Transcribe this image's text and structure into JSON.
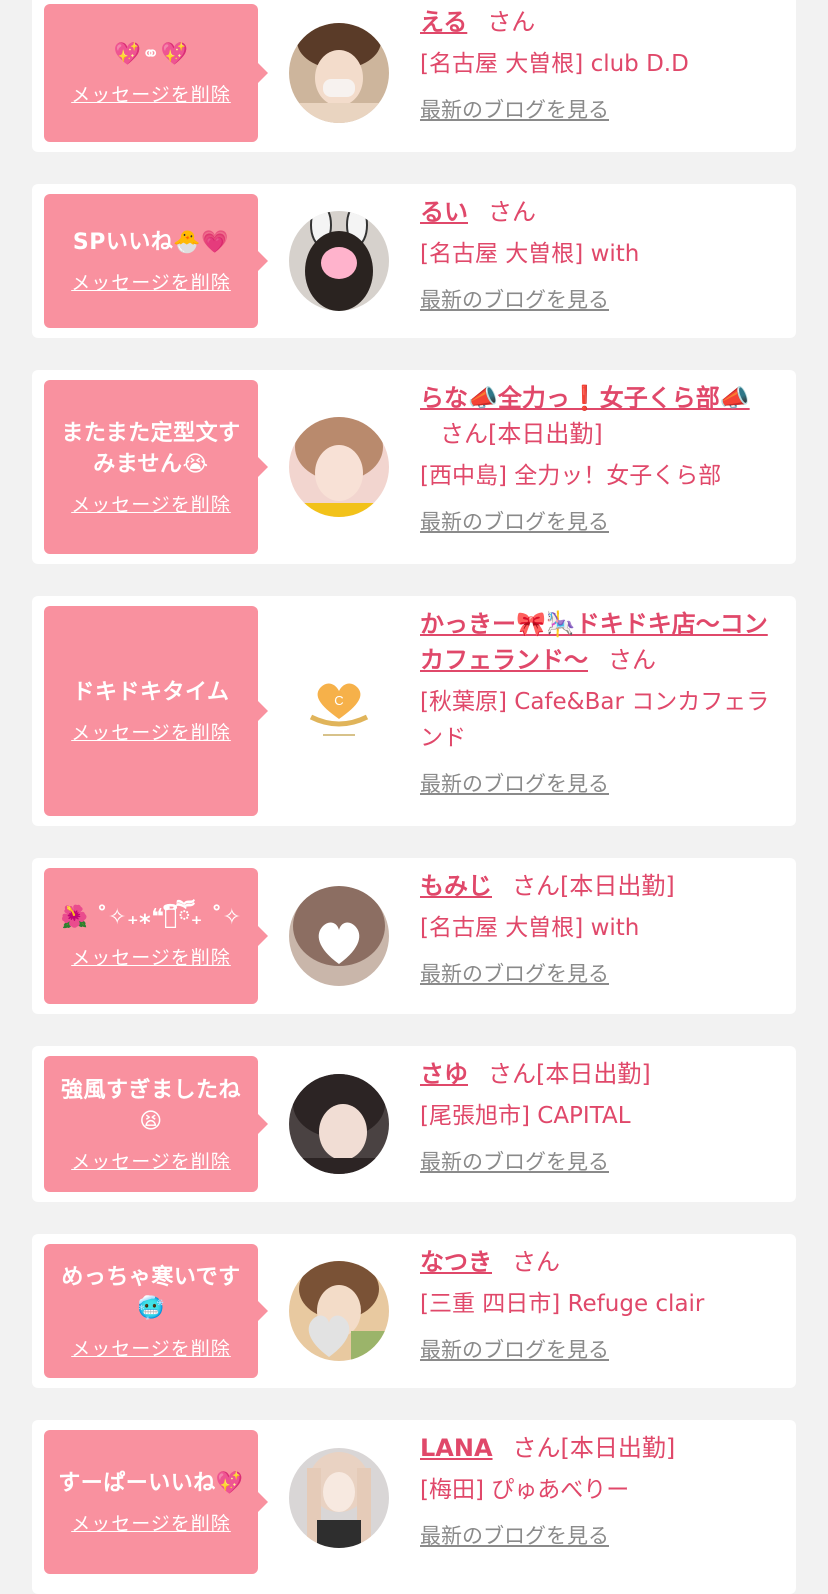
{
  "delete_label": "メッセージを削除",
  "blog_label": "最新のブログを見る",
  "san_label": "さん",
  "cards": [
    {
      "message": "💖⚭💖",
      "name": "える",
      "suffix": "",
      "shop": "[名古屋 大曽根] club D.D",
      "avatar": "photo"
    },
    {
      "message": "SPいいね🐣💗",
      "name": "るい",
      "suffix": "",
      "shop": "[名古屋 大曽根] with",
      "avatar": "photo"
    },
    {
      "message": "またまた定型文すみません😭",
      "name": "らな📣全力っ❗女子くら部📣",
      "suffix": "[本日出勤]",
      "shop": "[西中島] 全力ッ！女子くら部",
      "avatar": "photo"
    },
    {
      "message": "ドキドキタイム",
      "name": "かっきー🎀🎠ドキドキ店〜コンカフェランド〜",
      "suffix": "",
      "shop": "[秋葉原] Cafe&Bar コンカフェランド",
      "avatar": "logo"
    },
    {
      "message": "🌺 ˚✧₊⁎❝᷀ົཽ₊ ˚✧",
      "name": "もみじ",
      "suffix": "[本日出勤]",
      "shop": "[名古屋 大曽根] with",
      "avatar": "photo"
    },
    {
      "message": "強風すぎましたね😫",
      "name": "さゆ",
      "suffix": "[本日出勤]",
      "shop": "[尾張旭市] CAPITAL",
      "avatar": "photo"
    },
    {
      "message": "めっちゃ寒いです🥶",
      "name": "なつき",
      "suffix": "",
      "shop": "[三重 四日市] Refuge clair",
      "avatar": "photo"
    },
    {
      "message": "すーぱーいいね💖",
      "name": "LANA",
      "suffix": "[本日出勤]",
      "shop": "[梅田] ぴゅあべりー",
      "avatar": "photo"
    }
  ]
}
